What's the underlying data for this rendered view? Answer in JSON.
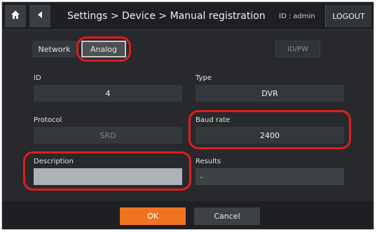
{
  "header": {
    "home_icon": "home-icon",
    "back_icon": "back-arrow-icon",
    "breadcrumb": "Settings > Device > Manual registration",
    "user_id": "ID : admin",
    "logout_label": "LOGOUT"
  },
  "tabs": {
    "network_label": "Network",
    "analog_label": "Analog",
    "selected": "Analog",
    "idpw_label": "ID/PW"
  },
  "form": {
    "id": {
      "label": "ID",
      "value": "4"
    },
    "type": {
      "label": "Type",
      "value": "DVR"
    },
    "protocol": {
      "label": "Protocol",
      "value": "SRD"
    },
    "baud_rate": {
      "label": "Baud rate",
      "value": "2400"
    },
    "description": {
      "label": "Description",
      "value": ""
    },
    "results": {
      "label": "Results",
      "value": "–"
    }
  },
  "footer": {
    "ok_label": "OK",
    "cancel_label": "Cancel"
  },
  "colors": {
    "panel": "#27292c",
    "field": "#34373b",
    "accent": "#ee7420",
    "highlight": "#e21b1b"
  }
}
